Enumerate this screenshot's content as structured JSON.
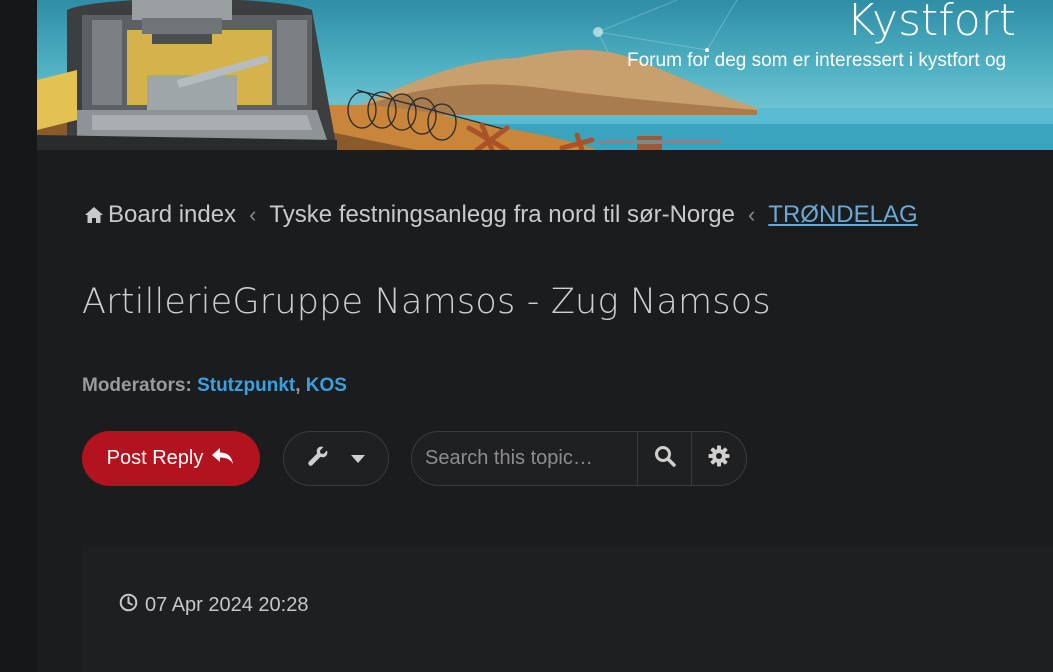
{
  "header": {
    "site_title": "Kystfort",
    "site_description": "Forum for deg som er interessert i kystfort og"
  },
  "breadcrumbs": [
    {
      "label": "Board index",
      "icon": "home-icon"
    },
    {
      "label": "Tyske festningsanlegg fra nord til sør-Norge"
    },
    {
      "label": "TRØNDELAG",
      "active": true
    }
  ],
  "breadcrumb_separator": "‹",
  "topic": {
    "title": "ArtillerieGruppe Namsos - Zug Namsos",
    "moderators_label": "Moderators:",
    "moderators": [
      "Stutzpunkt",
      "KOS"
    ],
    "moderator_separator": ","
  },
  "actions": {
    "post_reply_label": "Post Reply",
    "post_reply_icon": "reply-icon",
    "tools_icon": "wrench-icon",
    "tools_caret_icon": "caret-down-icon",
    "search_placeholder": "Search this topic…",
    "search_icon": "search-icon",
    "advanced_search_icon": "gear-icon"
  },
  "post": {
    "date_icon": "clock-icon",
    "date": "07 Apr 2024 20:28"
  },
  "colors": {
    "background": "#1b1c1e",
    "accent_red": "#b3121f",
    "link_blue": "#3ca0e0",
    "active_crumb": "#6aa9d6"
  }
}
